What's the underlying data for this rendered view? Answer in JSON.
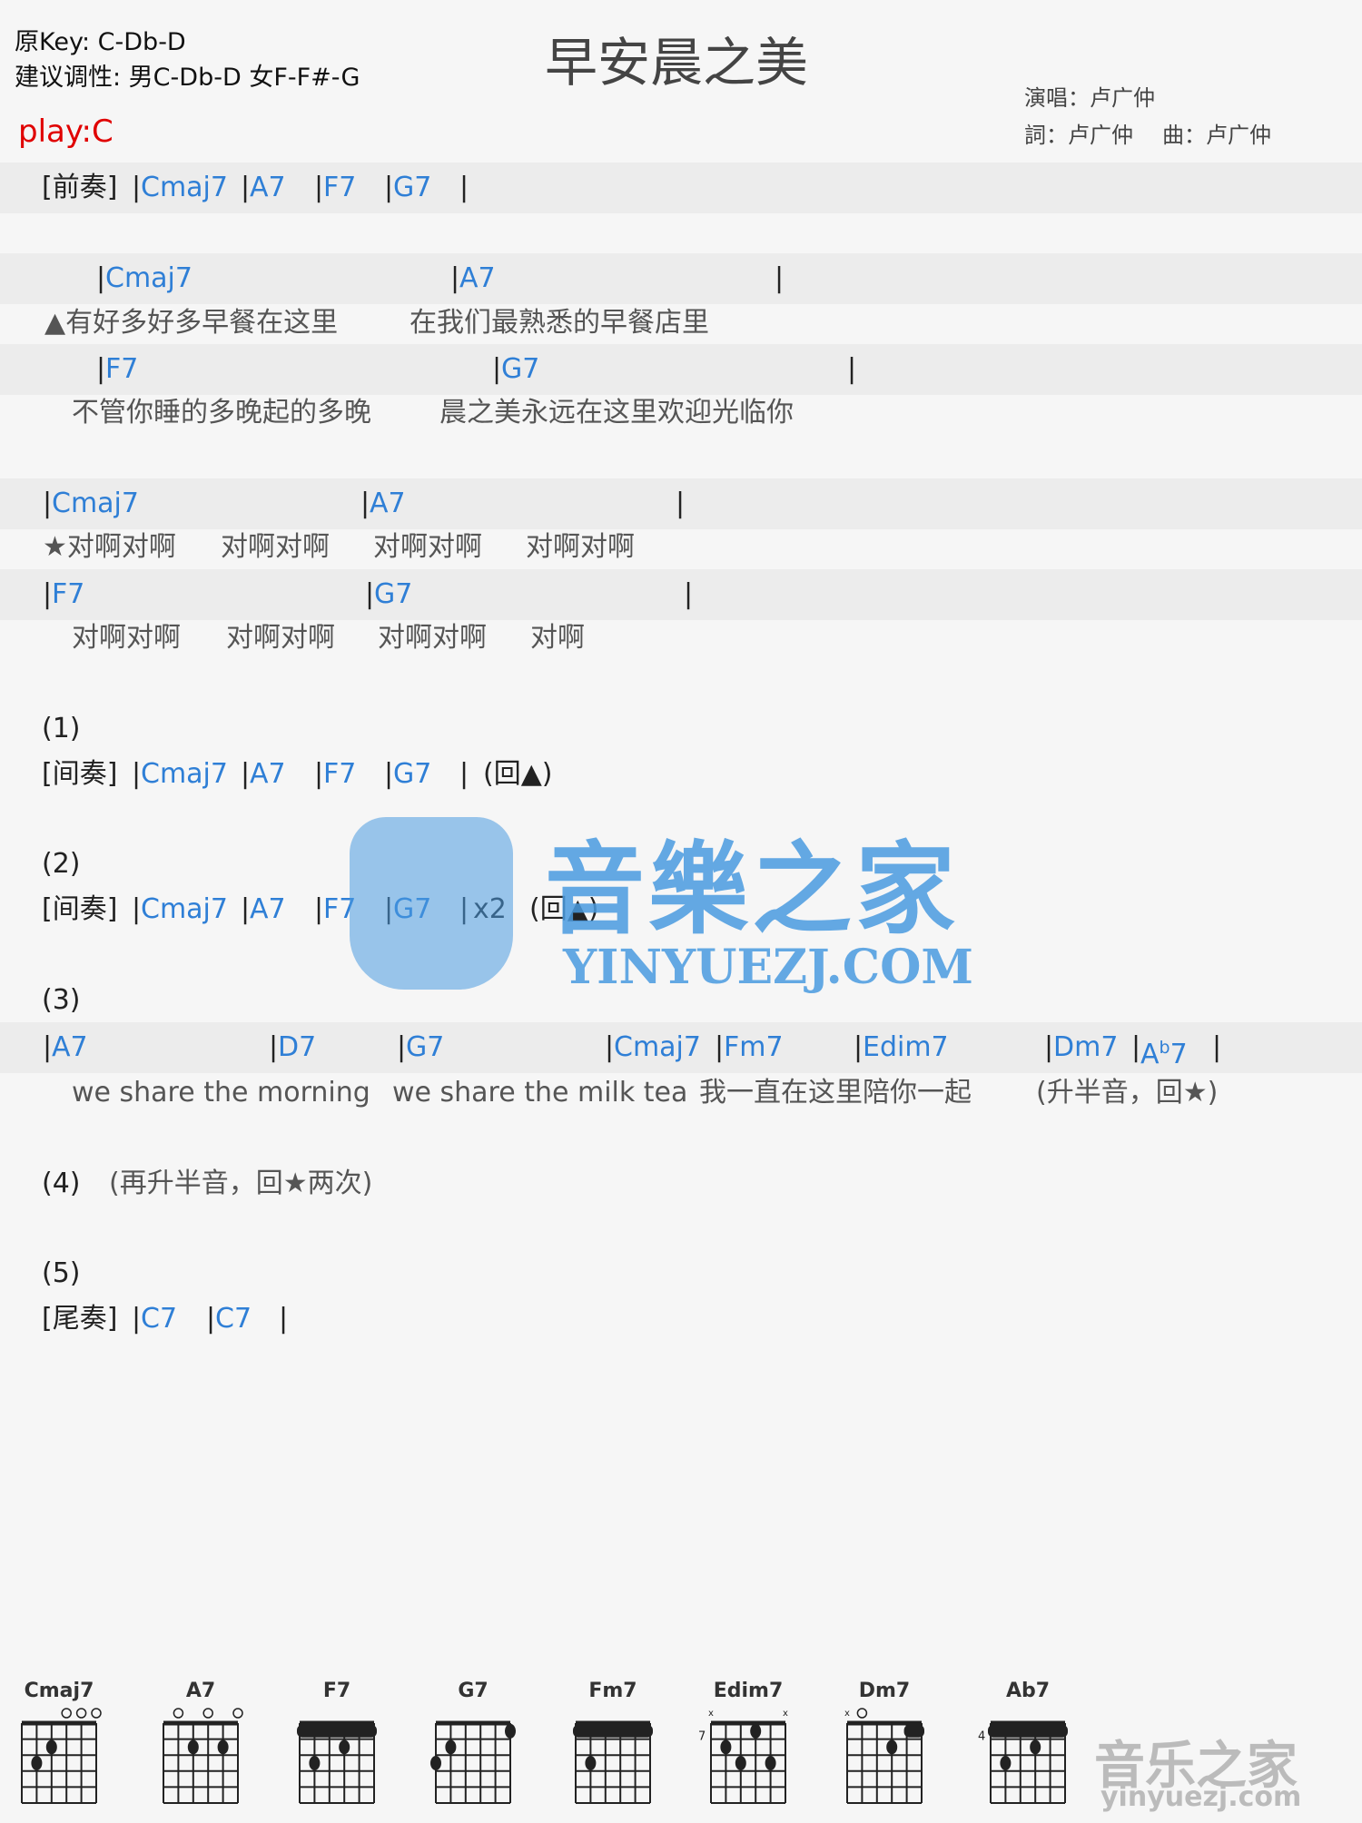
{
  "header": {
    "original_key": "原Key: C-Db-D",
    "suggested_key": "建议调性: 男C-Db-D 女F-F#-G",
    "title": "早安晨之美",
    "play": "play:C",
    "singer": "演唱：卢广仲",
    "lyricist": "詞：卢广仲",
    "composer": "曲：卢广仲"
  },
  "bar": "|",
  "lines": [
    {
      "type": "chord",
      "segs": [
        {
          "label": "[前奏]"
        },
        {
          "chord": "Cmaj7"
        },
        {
          "chord": "A7"
        },
        {
          "chord": "F7"
        },
        {
          "chord": "G7"
        },
        {
          "end": "|"
        }
      ]
    },
    {
      "type": "chord",
      "segs": [
        {
          "chord": "Cmaj7"
        },
        {
          "chord": "A7"
        },
        {
          "end": "|"
        }
      ]
    },
    {
      "type": "lyric",
      "segs": [
        {
          "lyric": "▲有好多好多早餐在这里"
        },
        {
          "lyric": "在我们最熟悉的早餐店里"
        }
      ]
    },
    {
      "type": "chord",
      "segs": [
        {
          "chord": "F7"
        },
        {
          "chord": "G7"
        },
        {
          "end": "|"
        }
      ]
    },
    {
      "type": "lyric",
      "segs": [
        {
          "lyric": "不管你睡的多晚起的多晚"
        },
        {
          "lyric": "晨之美永远在这里欢迎光临你"
        }
      ]
    },
    {
      "type": "chord",
      "segs": [
        {
          "chord": "Cmaj7"
        },
        {
          "chord": "A7"
        },
        {
          "end": "|"
        }
      ]
    },
    {
      "type": "lyric",
      "segs": [
        {
          "lyric": "★对啊对啊"
        },
        {
          "lyric": "对啊对啊"
        },
        {
          "lyric": "对啊对啊"
        },
        {
          "lyric": "对啊对啊"
        }
      ]
    },
    {
      "type": "chord",
      "segs": [
        {
          "chord": "F7"
        },
        {
          "chord": "G7"
        },
        {
          "end": "|"
        }
      ]
    },
    {
      "type": "lyric",
      "segs": [
        {
          "lyric": "对啊对啊"
        },
        {
          "lyric": "对啊对啊"
        },
        {
          "lyric": "对啊对啊"
        },
        {
          "lyric": "对啊"
        }
      ]
    },
    {
      "type": "text",
      "segs": [
        {
          "note": "(1)"
        }
      ]
    },
    {
      "type": "text",
      "segs": [
        {
          "label": "[间奏]"
        },
        {
          "chord": "Cmaj7"
        },
        {
          "chord": "A7"
        },
        {
          "chord": "F7"
        },
        {
          "chord": "G7"
        },
        {
          "end": "|"
        },
        {
          "note": "(回▲)"
        }
      ]
    },
    {
      "type": "text",
      "segs": [
        {
          "note": "(2)"
        }
      ]
    },
    {
      "type": "text",
      "segs": [
        {
          "label": "[间奏]"
        },
        {
          "chord": "Cmaj7"
        },
        {
          "chord": "A7"
        },
        {
          "chord": "F7"
        },
        {
          "chord": "G7"
        },
        {
          "end": "|"
        },
        {
          "note": "x2"
        },
        {
          "note": "(回▲)"
        }
      ]
    },
    {
      "type": "text",
      "segs": [
        {
          "note": "(3)"
        }
      ]
    },
    {
      "type": "chord",
      "segs": [
        {
          "chord": "A7"
        },
        {
          "chord": "D7"
        },
        {
          "chord": "G7"
        },
        {
          "chord": "Cmaj7"
        },
        {
          "chord": "Fm7"
        },
        {
          "chord": "Edim7"
        },
        {
          "chord": "Dm7"
        },
        {
          "chord": "A",
          "sup": "b",
          "tail": "7"
        },
        {
          "end": "|"
        }
      ]
    },
    {
      "type": "lyric",
      "segs": [
        {
          "lyric": "we share the morning"
        },
        {
          "lyric": "we share the milk tea"
        },
        {
          "lyric": "我一直在这里陪你一起"
        },
        {
          "lyric": "(升半音，回★)"
        }
      ]
    },
    {
      "type": "text",
      "segs": [
        {
          "note": "(4)"
        },
        {
          "lyric": "(再升半音，回★两次)"
        }
      ]
    },
    {
      "type": "text",
      "segs": [
        {
          "note": "(5)"
        }
      ]
    },
    {
      "type": "text",
      "segs": [
        {
          "label": "[尾奏]"
        },
        {
          "chord": "C7"
        },
        {
          "chord": "C7"
        },
        {
          "end": "|"
        }
      ]
    }
  ],
  "watermark": {
    "logo_text": "音樂之家",
    "logo_url_text": "YINYUEZJ.COM",
    "color": "#4a9be0"
  },
  "footer_logo": {
    "logo_text": "音乐之家",
    "logo_url_text": "yinyuezj.com"
  },
  "chord_diagrams": [
    {
      "name": "Cmaj7",
      "open": [
        4,
        5,
        6
      ],
      "muted": [],
      "barre": null,
      "dots": [
        [
          2,
          3
        ],
        [
          3,
          2
        ]
      ]
    },
    {
      "name": "A7",
      "open": [
        2,
        4,
        6
      ],
      "muted": [],
      "barre": null,
      "dots": [
        [
          3,
          2
        ],
        [
          5,
          2
        ]
      ]
    },
    {
      "name": "F7",
      "open": [],
      "muted": [],
      "barre": [
        1,
        6,
        1
      ],
      "dots": [
        [
          4,
          2
        ],
        [
          2,
          3
        ]
      ]
    },
    {
      "name": "G7",
      "open": [],
      "muted": [],
      "barre": null,
      "dots": [
        [
          6,
          1
        ],
        [
          2,
          2
        ],
        [
          1,
          3
        ]
      ]
    },
    {
      "name": "Fm7",
      "open": [],
      "muted": [],
      "barre": [
        1,
        6,
        1
      ],
      "dots": [
        [
          2,
          3
        ]
      ]
    },
    {
      "name": "Edim7",
      "position": "7",
      "open": [],
      "muted": [
        1,
        6
      ],
      "barre": null,
      "dots": [
        [
          4,
          1
        ],
        [
          2,
          2
        ],
        [
          3,
          3
        ],
        [
          5,
          3
        ]
      ]
    },
    {
      "name": "Dm7",
      "open": [
        2
      ],
      "muted": [
        1
      ],
      "barre": [
        5,
        6,
        1
      ],
      "dots": [
        [
          4,
          2
        ]
      ]
    },
    {
      "name": "Ab7",
      "position": "4",
      "open": [],
      "muted": [],
      "barre": [
        1,
        6,
        1
      ],
      "dots": [
        [
          4,
          2
        ],
        [
          2,
          3
        ]
      ]
    }
  ],
  "colors": {
    "chord": "#2f7fd6",
    "play": "#e00000",
    "lyric": "#555555"
  }
}
